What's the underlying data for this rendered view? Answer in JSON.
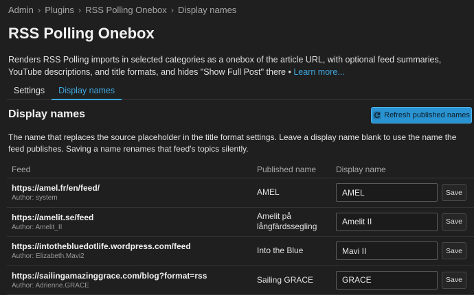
{
  "breadcrumb": [
    "Admin",
    "Plugins",
    "RSS Polling Onebox",
    "Display names"
  ],
  "page": {
    "title": "RSS Polling Onebox",
    "description": "Renders RSS Polling imports in selected categories as a onebox of the article URL, with optional feed summaries, YouTube descriptions, and title formats, and hides \"Show Full Post\" there •",
    "learn_more": "Learn more..."
  },
  "tabs": [
    {
      "label": "Settings",
      "active": false
    },
    {
      "label": "Display names",
      "active": true
    }
  ],
  "section": {
    "title": "Display names",
    "refresh_label": "Refresh published names",
    "refresh_icon": "refresh-icon",
    "description": "The name that replaces the source placeholder in the title format settings. Leave a display name blank to use the name the feed publishes. Saving a name renames that feed's topics silently."
  },
  "table": {
    "headers": {
      "feed": "Feed",
      "published": "Published name",
      "display": "Display name"
    },
    "rows": [
      {
        "url": "https://amel.fr/en/feed/",
        "author": "Author: system",
        "published": "AMEL",
        "display": "AMEL",
        "save": "Save"
      },
      {
        "url": "https://amelit.se/feed",
        "author": "Author: Amelit_II",
        "published": "Amelit på långfärdssegling",
        "display": "Amelit II",
        "save": "Save"
      },
      {
        "url": "https://intothebluedotlife.wordpress.com/feed",
        "author": "Author: Elizabeth.Mavi2",
        "published": "Into the Blue",
        "display": "Mavi II",
        "save": "Save"
      },
      {
        "url": "https://sailingamazinggrace.com/blog?format=rss",
        "author": "Author: Adrienne.GRACE",
        "published": "Sailing GRACE",
        "display": "GRACE",
        "save": "Save"
      }
    ]
  },
  "colors": {
    "background": "#1f1f1f",
    "accent": "#3ea8e0",
    "primary_button": "#2a93d1"
  }
}
